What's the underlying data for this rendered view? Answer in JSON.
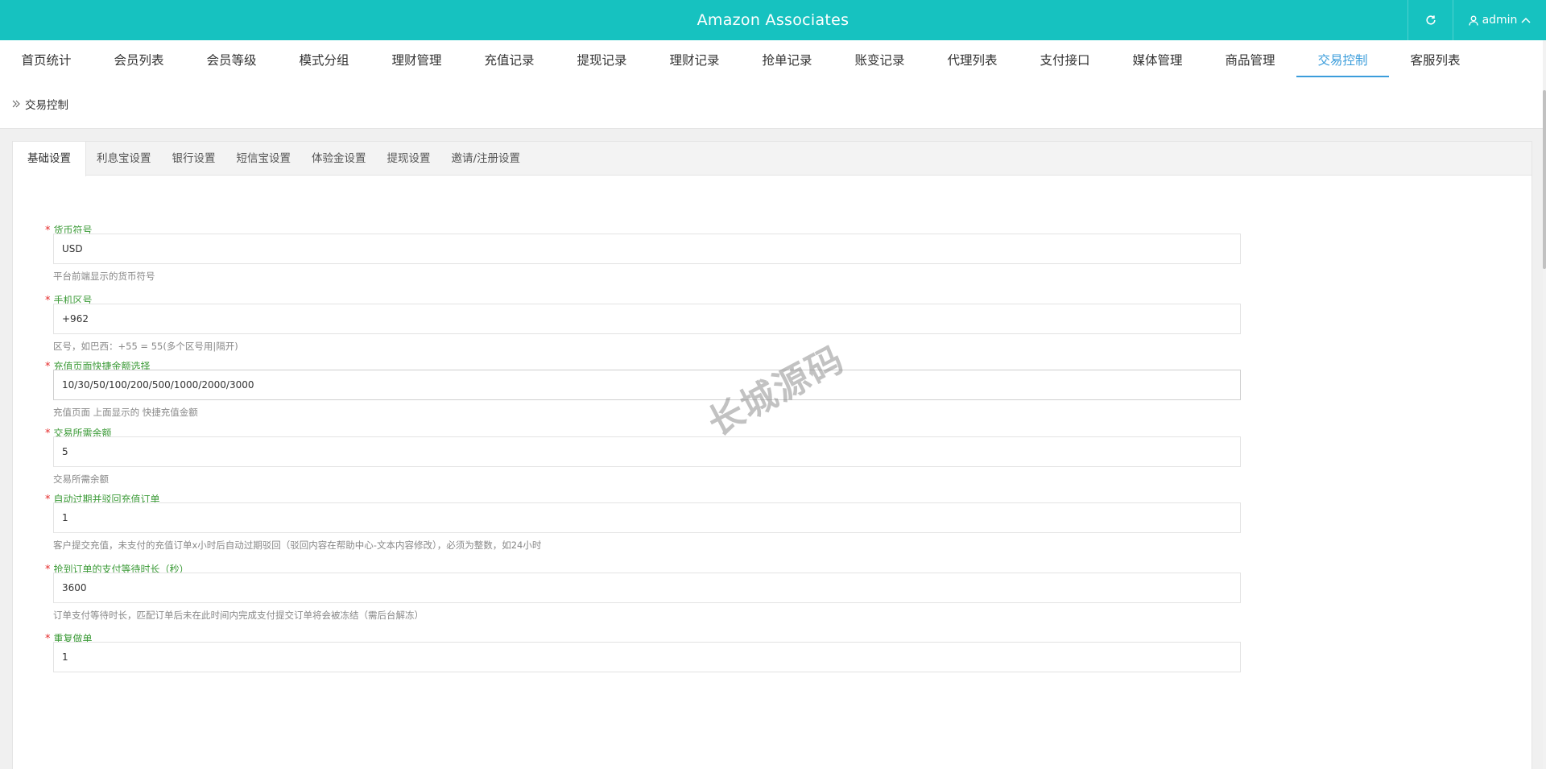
{
  "header": {
    "title": "Amazon Associates",
    "user": "admin",
    "icons": {
      "refresh": "refresh-icon",
      "user": "user-icon",
      "caret": "chevron-up-icon"
    }
  },
  "nav": {
    "items": [
      "首页统计",
      "会员列表",
      "会员等级",
      "模式分组",
      "理财管理",
      "充值记录",
      "提现记录",
      "理财记录",
      "抢单记录",
      "账变记录",
      "代理列表",
      "支付接口",
      "媒体管理",
      "商品管理",
      "交易控制",
      "客服列表"
    ],
    "active_index": 14
  },
  "breadcrumb": {
    "label": "交易控制",
    "icon": "double-chevron-right-icon"
  },
  "tabs": {
    "items": [
      "基础设置",
      "利息宝设置",
      "银行设置",
      "短信宝设置",
      "体验金设置",
      "提现设置",
      "邀请/注册设置"
    ],
    "active_index": 0
  },
  "form": {
    "fields": [
      {
        "label": "货币符号",
        "value": "USD",
        "help": "平台前端显示的货币符号"
      },
      {
        "label": "手机区号",
        "value": "+962",
        "help": "区号，如巴西：+55 = 55(多个区号用|隔开)"
      },
      {
        "label": "充值页面快捷金额选择",
        "value": "10/30/50/100/200/500/1000/2000/3000",
        "help": "充值页面 上面显示的 快捷充值金额"
      },
      {
        "label": "交易所需余额",
        "value": "5",
        "help": "交易所需余额"
      },
      {
        "label": "自动过期并驳回充值订单",
        "value": "1",
        "help": "客户提交充值，未支付的充值订单x小时后自动过期驳回（驳回内容在帮助中心-文本内容修改），必须为整数，如24小时"
      },
      {
        "label": "抢到订单的支付等待时长（秒）",
        "value": "3600",
        "help": "订单支付等待时长，匹配订单后未在此时间内完成支付提交订单将会被冻结（需后台解冻）"
      },
      {
        "label": "重复做单",
        "value": "1",
        "help": ""
      }
    ]
  },
  "watermark": "长城源码",
  "colors": {
    "header": "#16c2c0",
    "accent": "#3b9ddb",
    "label": "#3a9a36",
    "required": "#e52b2b"
  }
}
